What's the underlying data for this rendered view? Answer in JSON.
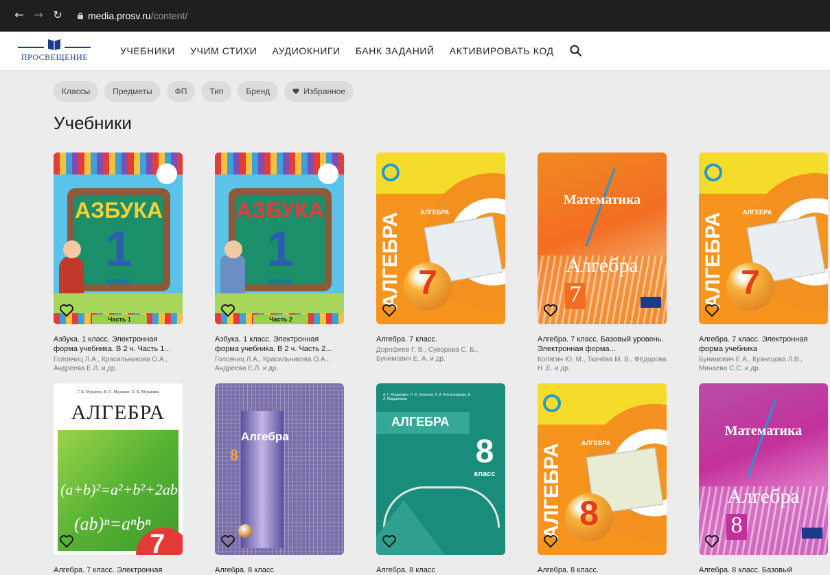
{
  "browser": {
    "url_host": "media.prosv.ru",
    "url_path": "/content/"
  },
  "header": {
    "logo_text": "ПРОСВЕЩЕНИЕ",
    "nav": [
      "УЧЕБНИКИ",
      "УЧИМ СТИХИ",
      "АУДИОКНИГИ",
      "БАНК ЗАДАНИЙ",
      "АКТИВИРОВАТЬ КОД"
    ]
  },
  "filters": [
    "Классы",
    "Предметы",
    "ФП",
    "Тип",
    "Бренд",
    "Избранное"
  ],
  "page_title": "Учебники",
  "books": [
    {
      "title": "Азбука. 1 класс. Электронная форма учебника. В 2 ч. Часть 1...",
      "authors": "Головчиц Л.А., Красильникова О.А., Андреева Е.Л. и др.",
      "cover": {
        "main": "АЗБУКА",
        "num": "1",
        "sub": "класс",
        "part": "Часть 1"
      }
    },
    {
      "title": "Азбука. 1 класс. Электронная форма учебника. В 2 ч. Часть 2...",
      "authors": "Головчиц Л.А., Красильникова О.А., Андреева Е.Л. и др.",
      "cover": {
        "main": "АЗБУКА",
        "num": "1",
        "sub": "класс",
        "part": "Часть 2"
      }
    },
    {
      "title": "Алгебра. 7 класс.",
      "authors": "Дорофеев Г. В., Суворова С. Б., Бунимович Е. А. и др.",
      "cover": {
        "main": "АЛГЕБРА",
        "small": "АЛГЕБРА",
        "num": "7"
      }
    },
    {
      "title": "Алгебра. 7 класс. Базовый уровень. Электронная форма...",
      "authors": "Колягин Ю. М., Ткачёва М. В., Фёдорова Н .Е. и др.",
      "cover": {
        "top": "Математика",
        "main": "Алгебра",
        "num": "7"
      }
    },
    {
      "title": "Алгебра. 7 класс. Электронная форма учебника",
      "authors": "Бунимович Е.А., Кузнецова Л.В., Минаева С.С. и др.",
      "cover": {
        "main": "АЛГЕБРА",
        "small": "АЛГЕБРА",
        "num": "7"
      }
    },
    {
      "title": "Алгебра. 7 класс. Электронная",
      "authors": "",
      "cover": {
        "top": "Г. К. Муравин, К. С. Муравин, О. В. Муравина",
        "main": "АЛГЕБРА",
        "formula1": "(a+b)²=a²+b²+2ab",
        "formula2": "(ab)ⁿ=aⁿbⁿ",
        "num": "7"
      }
    },
    {
      "title": "Алгебра. 8 класс",
      "authors": "",
      "cover": {
        "main": "Алгебра",
        "num": "8"
      }
    },
    {
      "title": "Алгебра. 8 класс",
      "authors": "",
      "cover": {
        "top": "А. Г. Мордкович, П. В. Семенов, Л. А. Александрова, Е. Л. Мардахаева",
        "main": "АЛГЕБРА",
        "num": "8",
        "sub": "класс"
      }
    },
    {
      "title": "Алгебра. 8 класс.",
      "authors": "",
      "cover": {
        "main": "АЛГЕБРА",
        "small": "АЛГЕБРА",
        "num": "8"
      }
    },
    {
      "title": "Алгебра. 8 класс. Базовый",
      "authors": "",
      "cover": {
        "top": "Математика",
        "main": "Алгебра",
        "num": "8"
      }
    }
  ]
}
